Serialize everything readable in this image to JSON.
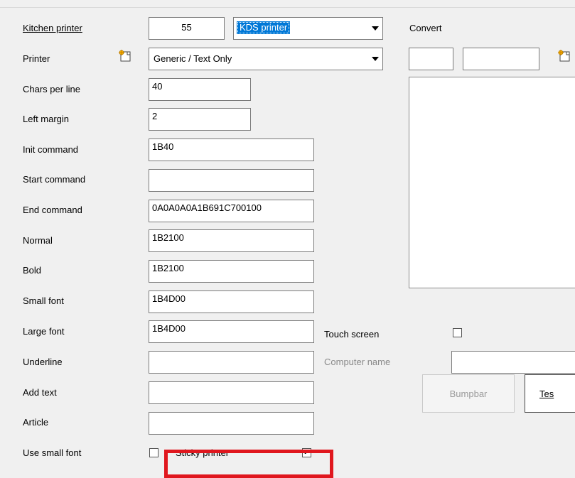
{
  "labels": {
    "kitchen_printer": "Kitchen printer",
    "printer": "Printer",
    "chars_per_line": "Chars per line",
    "left_margin": "Left margin",
    "init_command": "Init command",
    "start_command": "Start command",
    "end_command": "End command",
    "normal": "Normal",
    "bold": "Bold",
    "small_font": "Small font",
    "large_font": "Large font",
    "underline": "Underline",
    "add_text": "Add text",
    "article": "Article",
    "use_small_font": "Use small font",
    "convert": "Convert",
    "touch_screen": "Touch screen",
    "computer_name": "Computer name",
    "sticky_printer": "Sticky printer"
  },
  "values": {
    "kitchen_printer_number": "55",
    "kitchen_printer_type": "KDS printer",
    "printer_driver": "Generic / Text Only",
    "chars_per_line": "40",
    "left_margin": "2",
    "init_command": "1B40",
    "start_command": "",
    "end_command": "0A0A0A0A1B691C700100",
    "normal": "1B2100",
    "bold": "1B2100",
    "small_font": "1B4D00",
    "large_font": "1B4D00",
    "underline": "",
    "add_text": "",
    "article": "",
    "computer_name": "",
    "convert_from": "",
    "convert_to": ""
  },
  "checkboxes": {
    "use_small_font": false,
    "sticky_printer": true,
    "touch_screen": false
  },
  "buttons": {
    "bumpbar": "Bumpbar",
    "test": "Tes"
  },
  "icons": {
    "printer_browse": "folder-icon",
    "convert_browse": "folder-icon"
  },
  "colors": {
    "highlight_box": "#e0171e",
    "selection": "#0078d7"
  }
}
